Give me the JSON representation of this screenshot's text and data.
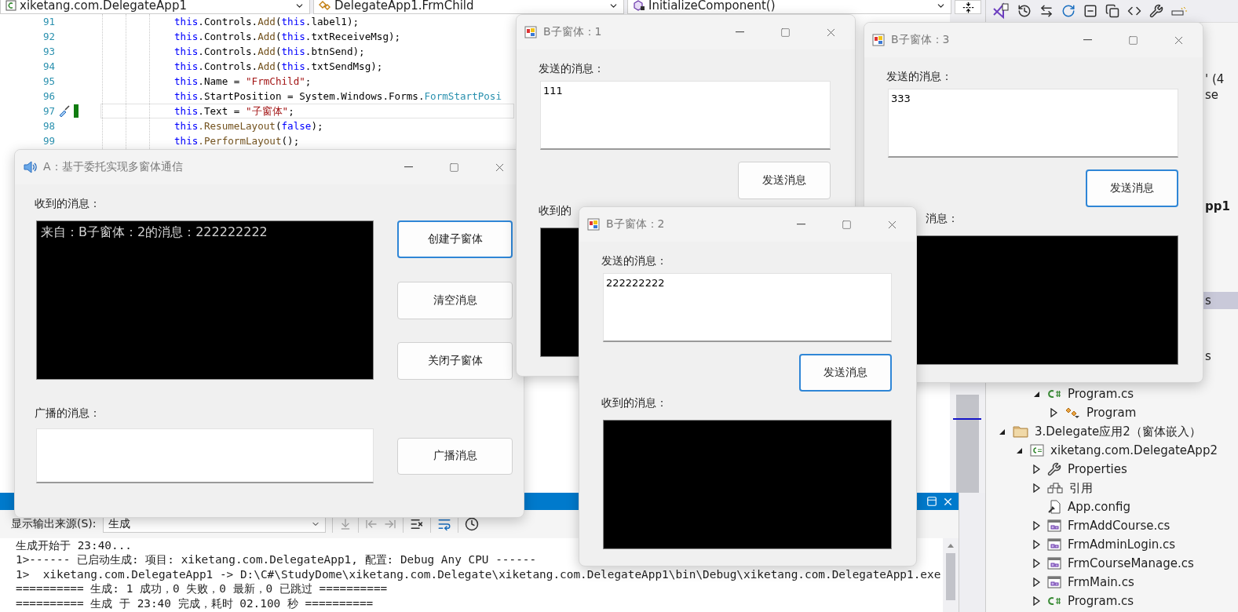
{
  "editor": {
    "nav_dropdowns": [
      {
        "kind": "project",
        "label": "xiketang.com.DelegateApp1"
      },
      {
        "kind": "class",
        "label": "DelegateApp1.FrmChild"
      },
      {
        "kind": "method",
        "label": "InitializeComponent()"
      }
    ],
    "lines": [
      {
        "number": "91",
        "current": false,
        "tokens": [
          {
            "kind": "kw",
            "text": "this"
          },
          {
            "kind": "plain",
            "text": ".Controls."
          },
          {
            "kind": "method",
            "text": "Add"
          },
          {
            "kind": "plain",
            "text": "("
          },
          {
            "kind": "kw",
            "text": "this"
          },
          {
            "kind": "plain",
            "text": ".label1);"
          }
        ]
      },
      {
        "number": "92",
        "current": false,
        "tokens": [
          {
            "kind": "kw",
            "text": "this"
          },
          {
            "kind": "plain",
            "text": ".Controls."
          },
          {
            "kind": "method",
            "text": "Add"
          },
          {
            "kind": "plain",
            "text": "("
          },
          {
            "kind": "kw",
            "text": "this"
          },
          {
            "kind": "plain",
            "text": ".txtReceiveMsg);"
          }
        ]
      },
      {
        "number": "93",
        "current": false,
        "tokens": [
          {
            "kind": "kw",
            "text": "this"
          },
          {
            "kind": "plain",
            "text": ".Controls."
          },
          {
            "kind": "method",
            "text": "Add"
          },
          {
            "kind": "plain",
            "text": "("
          },
          {
            "kind": "kw",
            "text": "this"
          },
          {
            "kind": "plain",
            "text": ".btnSend);"
          }
        ]
      },
      {
        "number": "94",
        "current": false,
        "tokens": [
          {
            "kind": "kw",
            "text": "this"
          },
          {
            "kind": "plain",
            "text": ".Controls."
          },
          {
            "kind": "method",
            "text": "Add"
          },
          {
            "kind": "plain",
            "text": "("
          },
          {
            "kind": "kw",
            "text": "this"
          },
          {
            "kind": "plain",
            "text": ".txtSendMsg);"
          }
        ]
      },
      {
        "number": "95",
        "current": false,
        "tokens": [
          {
            "kind": "kw",
            "text": "this"
          },
          {
            "kind": "plain",
            "text": ".Name = "
          },
          {
            "kind": "str",
            "text": "\"FrmChild\""
          },
          {
            "kind": "plain",
            "text": ";"
          }
        ]
      },
      {
        "number": "96",
        "current": false,
        "tokens": [
          {
            "kind": "kw",
            "text": "this"
          },
          {
            "kind": "plain",
            "text": ".StartPosition = System.Windows.Forms."
          },
          {
            "kind": "type",
            "text": "FormStartPosi"
          }
        ]
      },
      {
        "number": "97",
        "current": true,
        "tokens": [
          {
            "kind": "kw",
            "text": "this"
          },
          {
            "kind": "plain",
            "text": ".Text = "
          },
          {
            "kind": "str",
            "text": "\"子窗体\""
          },
          {
            "kind": "plain",
            "text": ";"
          }
        ]
      },
      {
        "number": "98",
        "current": false,
        "tokens": [
          {
            "kind": "kw",
            "text": "this"
          },
          {
            "kind": "method",
            "text": ".ResumeLayout"
          },
          {
            "kind": "plain",
            "text": "("
          },
          {
            "kind": "kw",
            "text": "false"
          },
          {
            "kind": "plain",
            "text": ");"
          }
        ]
      },
      {
        "number": "99",
        "current": false,
        "tokens": [
          {
            "kind": "kw",
            "text": "this"
          },
          {
            "kind": "method",
            "text": ".PerformLayout"
          },
          {
            "kind": "plain",
            "text": "();"
          }
        ]
      }
    ]
  },
  "output": {
    "source_label": "显示输出来源(S):",
    "source_value": "生成",
    "lines": [
      "生成开始于 23:40...",
      "1>------ 已启动生成: 项目: xiketang.com.DelegateApp1, 配置: Debug Any CPU ------",
      "1>  xiketang.com.DelegateApp1 -> D:\\C#\\StudyDome\\xiketang.com.Delegate\\xiketang.com.DelegateApp1\\bin\\Debug\\xiketang.com.DelegateApp1.exe",
      "========== 生成: 1 成功，0 失败，0 最新，0 已跳过 ==========",
      "========== 生成 于 23:40 完成，耗时 02.100 秒 =========="
    ]
  },
  "solution_explorer": {
    "fragments": [
      {
        "text": "' (4",
        "bold": false,
        "selected": false
      },
      {
        "text": "se",
        "bold": false,
        "selected": false
      },
      {
        "text": "pp1",
        "bold": true,
        "selected": false
      },
      {
        "text": "s",
        "bold": false,
        "selected": true
      },
      {
        "text": "s",
        "bold": false,
        "selected": false
      }
    ],
    "tree": [
      {
        "label": "Program.cs",
        "kind": "csharp",
        "expanded": true,
        "children": [
          {
            "label": "Program",
            "kind": "class",
            "expanded": false
          }
        ]
      },
      {
        "label": "3.Delegate应用2（窗体嵌入）",
        "kind": "folder",
        "expanded": true,
        "children": [
          {
            "label": "xiketang.com.DelegateApp2",
            "kind": "project",
            "expanded": true,
            "children": [
              {
                "label": "Properties",
                "kind": "properties",
                "expanded": false
              },
              {
                "label": "引用",
                "kind": "references",
                "expanded": false
              },
              {
                "label": "App.config",
                "kind": "config"
              },
              {
                "label": "FrmAddCourse.cs",
                "kind": "form",
                "expanded": false
              },
              {
                "label": "FrmAdminLogin.cs",
                "kind": "form",
                "expanded": false
              },
              {
                "label": "FrmCourseManage.cs",
                "kind": "form",
                "expanded": false
              },
              {
                "label": "FrmMain.cs",
                "kind": "form",
                "expanded": false
              },
              {
                "label": "Program.cs",
                "kind": "csharp",
                "expanded": false
              }
            ]
          }
        ]
      }
    ]
  },
  "windows": [
    {
      "kind": "main",
      "title": "A：基于委托实现多窗体通信",
      "received_label": "收到的消息：",
      "received_text": "来自：B子窗体：2的消息：222222222",
      "buttons": [
        {
          "label": "创建子窗体",
          "focused": true
        },
        {
          "label": "清空消息",
          "focused": false
        },
        {
          "label": "关闭子窗体",
          "focused": false
        }
      ],
      "broadcast_label": "广播的消息：",
      "broadcast_button": {
        "label": "广播消息",
        "focused": false
      }
    },
    {
      "kind": "child",
      "title": "B子窗体：1",
      "send_label": "发送的消息：",
      "send_text": "111",
      "send_button": {
        "label": "发送消息",
        "focused": false
      },
      "received_label": "收到的"
    },
    {
      "kind": "child",
      "title": "B子窗体：3",
      "send_label": "发送的消息：",
      "send_text": "333",
      "send_button": {
        "label": "发送消息",
        "focused": true
      },
      "received_label": "消息："
    },
    {
      "kind": "child",
      "title": "B子窗体：2",
      "send_label": "发送的消息：",
      "send_text": "222222222",
      "send_button": {
        "label": "发送消息",
        "focused": true
      },
      "received_label": "收到的消息："
    }
  ]
}
